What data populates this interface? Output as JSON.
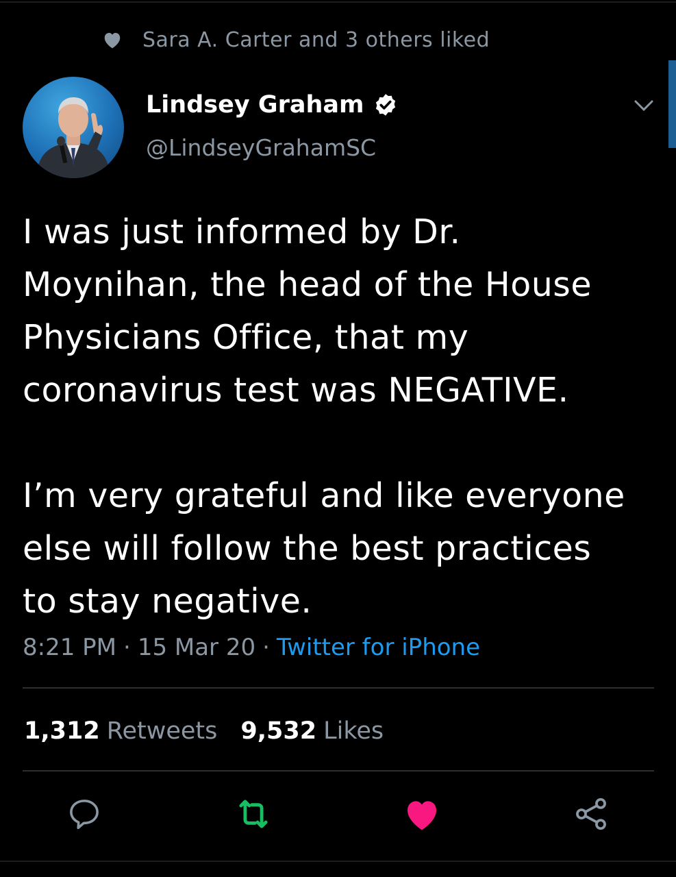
{
  "social_context": {
    "text": "Sara A. Carter and 3 others liked",
    "icon": "heart-icon"
  },
  "author": {
    "display_name": "Lindsey Graham",
    "handle": "@LindseyGrahamSC",
    "verified": true
  },
  "tweet": {
    "paragraphs": [
      "I was just informed by Dr. Moynihan, the head of the House Physicians Office, that my coronavirus test was NEGATIVE.",
      "I’m very grateful and like everyone else will follow the best practices to stay negative."
    ],
    "lines": [
      "I was just informed by Dr.",
      "Moynihan, the head of the House",
      "Physicians Office, that my",
      "coronavirus test was NEGATIVE.",
      "I’m very grateful and like everyone",
      "else will follow the best practices",
      "to stay negative."
    ],
    "time": "8:21 PM",
    "date": "15 Mar 20",
    "source": "Twitter for iPhone"
  },
  "stats": {
    "retweets_count": "1,312",
    "retweets_label": "Retweets",
    "likes_count": "9,532",
    "likes_label": "Likes"
  },
  "actions": {
    "reply_icon": "reply-icon",
    "retweet_icon": "retweet-icon",
    "like_icon": "heart-icon",
    "share_icon": "share-icon",
    "liked": true
  },
  "colors": {
    "background": "#000000",
    "secondary_text": "#8b98a4",
    "link": "#1d9bf0",
    "retweet_green": "#17bf63",
    "like_pink": "#f91880"
  }
}
